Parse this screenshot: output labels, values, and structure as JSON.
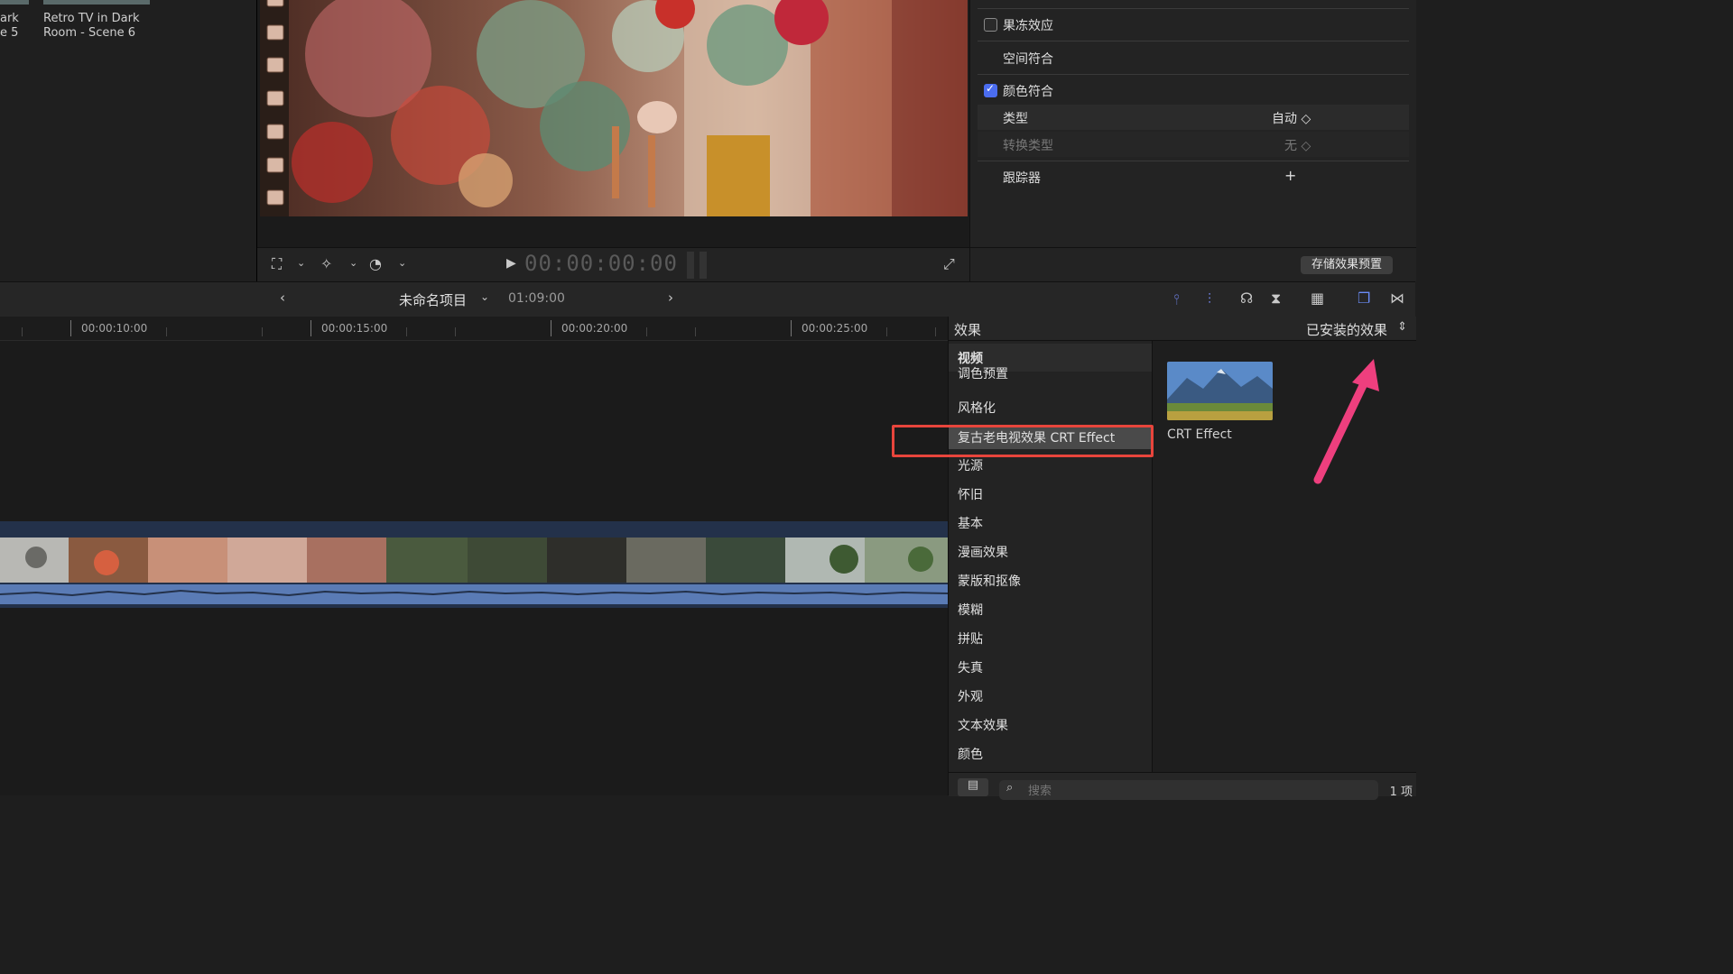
{
  "browser": {
    "clips": [
      {
        "line1": "ark",
        "line2": "e 5"
      },
      {
        "line1": "Retro TV in Dark",
        "line2": "Room - Scene 6"
      }
    ]
  },
  "viewer": {
    "timecode": "00:00:00:00"
  },
  "inspector": {
    "rows": [
      {
        "label": "果冻效应",
        "checkbox": true,
        "checked": false
      },
      {
        "label": "空间符合",
        "checkbox": false
      },
      {
        "label": "颜色符合",
        "checkbox": true,
        "checked": true
      },
      {
        "label": "类型",
        "value": "自动 ◇"
      },
      {
        "label": "转换类型",
        "value": "无 ◇"
      },
      {
        "label": "跟踪器",
        "value": "+"
      }
    ],
    "save_preset": "存储效果预置"
  },
  "timeline": {
    "project_name": "未命名项目",
    "duration": "01:09:00",
    "ruler": [
      "00:00:10:00",
      "00:00:15:00",
      "00:00:20:00",
      "00:00:25:00"
    ]
  },
  "effects": {
    "title": "效果",
    "installed_label": "已安装的效果",
    "categories": [
      "视频",
      "调色预置",
      "风格化",
      "复古老电视效果 CRT Effect",
      "光源",
      "怀旧",
      "基本",
      "漫画效果",
      "蒙版和抠像",
      "模糊",
      "拼贴",
      "失真",
      "外观",
      "文本效果",
      "颜色"
    ],
    "selected_index": 3,
    "effect_thumb_label": "CRT Effect",
    "search_placeholder": "搜索",
    "item_count": "1 项"
  },
  "colors": {
    "accent": "#4b6df0",
    "highlight_box": "#e8453c",
    "annotation_arrow": "#ee3f7e"
  }
}
